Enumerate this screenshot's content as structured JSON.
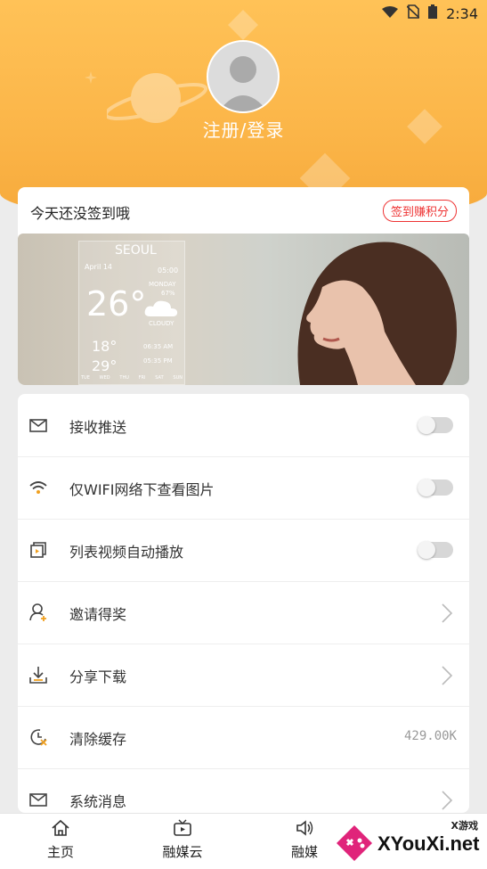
{
  "status_bar": {
    "time": "2:34"
  },
  "profile": {
    "login_label": "注册/登录"
  },
  "signin": {
    "text": "今天还没签到哦",
    "badge": "签到赚积分"
  },
  "banner": {
    "city": "SEOUL",
    "date": "April 14",
    "time": "05:00",
    "day": "MONDAY",
    "humidity": "67%",
    "temp": "26°",
    "condition": "CLOUDY",
    "low": "18°",
    "high": "29°",
    "sunrise": "06:35 AM",
    "sunset": "05:35 PM",
    "weekdays": [
      "TUE",
      "WED",
      "THU",
      "FRI",
      "SAT",
      "SUN"
    ]
  },
  "settings": [
    {
      "label": "接收推送",
      "icon": "push-icon",
      "control": "toggle",
      "on": false
    },
    {
      "label": "仅WIFI网络下查看图片",
      "icon": "wifi-icon",
      "control": "toggle",
      "on": false
    },
    {
      "label": "列表视频自动播放",
      "icon": "video-icon",
      "control": "toggle",
      "on": false
    },
    {
      "label": "邀请得奖",
      "icon": "invite-icon",
      "control": "chevron"
    },
    {
      "label": "分享下载",
      "icon": "download-icon",
      "control": "chevron"
    },
    {
      "label": "清除缓存",
      "icon": "clock-icon",
      "control": "value",
      "value": "429.00K"
    },
    {
      "label": "系统消息",
      "icon": "mail-icon",
      "control": "chevron"
    }
  ],
  "tabs": [
    {
      "label": "主页",
      "icon": "home-icon"
    },
    {
      "label": "融媒云",
      "icon": "video-cloud-icon"
    },
    {
      "label": "融媒",
      "icon": "speaker-icon"
    }
  ],
  "watermark": {
    "text": "XYouXi.net",
    "small": "X游戏"
  }
}
